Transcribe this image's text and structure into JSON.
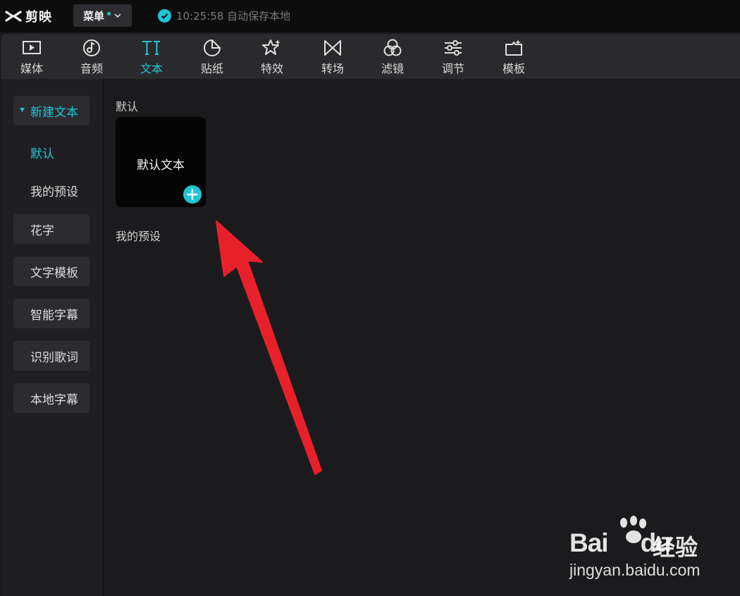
{
  "app": {
    "name": "剪映"
  },
  "titlebar": {
    "menu_label": "菜单",
    "save_status": "10:25:58 自动保存本地"
  },
  "toolbar": {
    "active": "文本",
    "items": [
      {
        "label": "媒体",
        "icon": "media-icon"
      },
      {
        "label": "音频",
        "icon": "audio-icon"
      },
      {
        "label": "文本",
        "icon": "text-icon"
      },
      {
        "label": "贴纸",
        "icon": "sticker-icon"
      },
      {
        "label": "特效",
        "icon": "effects-icon"
      },
      {
        "label": "转场",
        "icon": "transition-icon"
      },
      {
        "label": "滤镜",
        "icon": "filter-icon"
      },
      {
        "label": "调节",
        "icon": "adjust-icon"
      },
      {
        "label": "模板",
        "icon": "template-icon"
      }
    ]
  },
  "sidebar": {
    "new_text": "新建文本",
    "sub_items": [
      "默认",
      "我的预设"
    ],
    "items": [
      "花字",
      "文字模板",
      "智能字幕",
      "识别歌词",
      "本地字幕"
    ]
  },
  "content": {
    "section_default": "默认",
    "default_card_text": "默认文本",
    "section_presets": "我的预设"
  },
  "colors": {
    "accent": "#20c5d4",
    "annotation_arrow": "#e8202a"
  },
  "watermark": {
    "brand_text": "Bai",
    "brand_text_2": "du",
    "brand_cn": "经验",
    "url": "jingyan.baidu.com"
  }
}
